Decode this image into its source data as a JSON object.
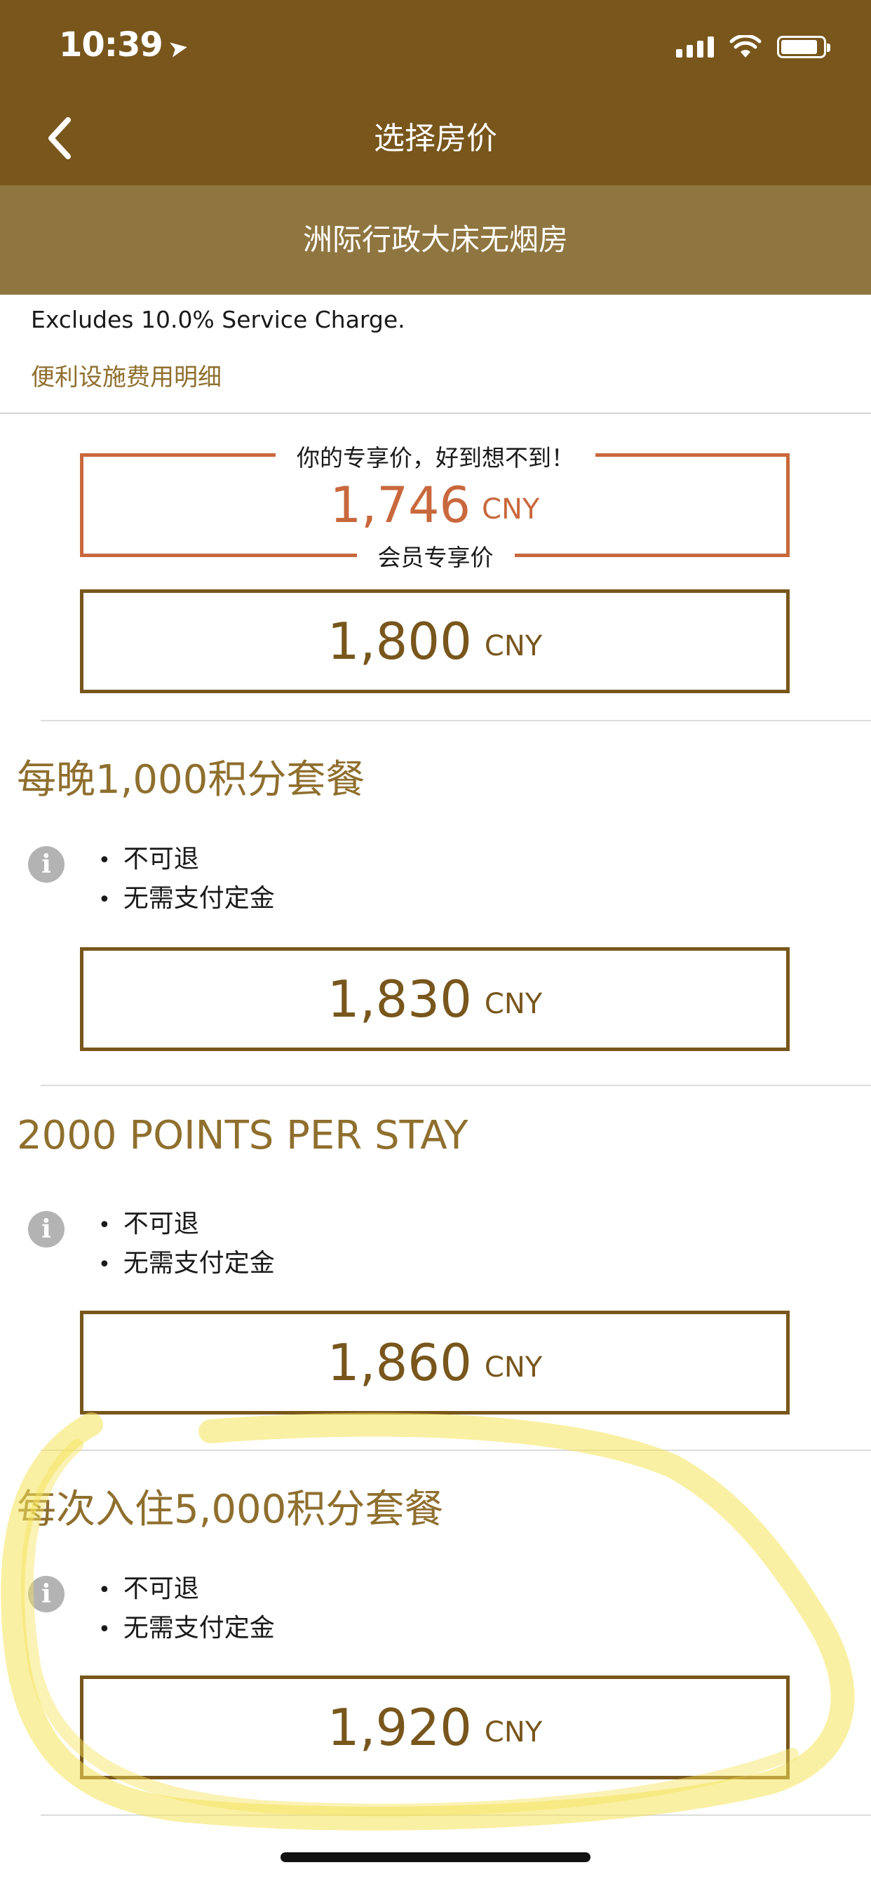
{
  "status": {
    "time": "10:39",
    "battery_level": 0.88
  },
  "nav": {
    "title": "选择房价",
    "back_icon": "chevron-left-icon"
  },
  "room": {
    "name": "洲际行政大床无烟房"
  },
  "info": {
    "service_note": "Excludes 10.0% Service Charge.",
    "fee_link": "便利设施费用明细"
  },
  "member_offer": {
    "top_label": "你的专享价，好到想不到！",
    "price": "1,746",
    "currency": "CNY",
    "bottom_label": "会员专享价",
    "accent_color": "#c9683d"
  },
  "standard_offer": {
    "price": "1,800",
    "currency": "CNY"
  },
  "packages": [
    {
      "title": "每晚1,000积分套餐",
      "policies": [
        "不可退",
        "无需支付定金"
      ],
      "price": "1,830",
      "currency": "CNY"
    },
    {
      "title": "2000 POINTS PER STAY",
      "policies": [
        "不可退",
        "无需支付定金"
      ],
      "price": "1,860",
      "currency": "CNY"
    },
    {
      "title": "每次入住5,000积分套餐",
      "policies": [
        "不可退",
        "无需支付定金"
      ],
      "price": "1,920",
      "currency": "CNY"
    }
  ],
  "colors": {
    "brand": "#78561c",
    "room_bar": "#8f7540",
    "link": "#8f6f2e",
    "highlight": "#f6e35a"
  }
}
